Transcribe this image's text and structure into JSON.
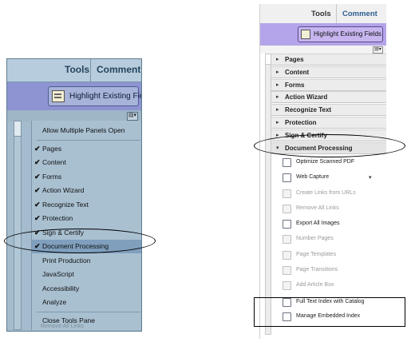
{
  "left_panel": {
    "tabs": {
      "tools": "Tools",
      "comment": "Comment"
    },
    "highlight_button": "Highlight Existing Fields",
    "menu": [
      {
        "label": "Allow Multiple Panels Open",
        "checked": false
      },
      {
        "label": "Pages",
        "checked": true
      },
      {
        "label": "Content",
        "checked": true
      },
      {
        "label": "Forms",
        "checked": true
      },
      {
        "label": "Action Wizard",
        "checked": true
      },
      {
        "label": "Recognize Text",
        "checked": true
      },
      {
        "label": "Protection",
        "checked": true
      },
      {
        "label": "Sign & Certify",
        "checked": true
      },
      {
        "label": "Document Processing",
        "checked": true,
        "selected": true
      },
      {
        "label": "Print Production",
        "checked": false
      },
      {
        "label": "JavaScript",
        "checked": false
      },
      {
        "label": "Accessibility",
        "checked": false
      },
      {
        "label": "Analyze",
        "checked": false
      },
      {
        "label": "Close Tools Pane",
        "checked": false
      }
    ],
    "check_glyph": "✔",
    "ghost_text": "Remove All Links"
  },
  "right_panel": {
    "tabs": {
      "tools": "Tools",
      "comment": "Comment"
    },
    "highlight_button": "Highlight Existing Fields",
    "sections": [
      {
        "label": "Pages",
        "open": false
      },
      {
        "label": "Content",
        "open": false
      },
      {
        "label": "Forms",
        "open": false
      },
      {
        "label": "Action Wizard",
        "open": false
      },
      {
        "label": "Recognize Text",
        "open": false
      },
      {
        "label": "Protection",
        "open": false
      },
      {
        "label": "Sign & Certify",
        "open": false
      },
      {
        "label": "Document Processing",
        "open": true
      }
    ],
    "tools": [
      {
        "label": "Optimize Scanned PDF",
        "enabled": true,
        "icon": "scan-icon"
      },
      {
        "label": "Web Capture",
        "enabled": true,
        "icon": "globe-icon",
        "dropdown": true
      },
      {
        "label": "Create Links from URLs",
        "enabled": false,
        "icon": "link-icon"
      },
      {
        "label": "Remove All Links",
        "enabled": false,
        "icon": "unlink-icon"
      },
      {
        "label": "Export All Images",
        "enabled": true,
        "icon": "image-export-icon"
      },
      {
        "label": "Number Pages",
        "enabled": false,
        "icon": "number-pages-icon"
      },
      {
        "label": "Page Templates",
        "enabled": false,
        "icon": "page-template-icon"
      },
      {
        "label": "Page Transitions",
        "enabled": false,
        "icon": "transition-icon"
      },
      {
        "label": "Add Article Box",
        "enabled": false,
        "icon": "article-box-icon"
      },
      {
        "label": "Full Text Index with Catalog",
        "enabled": true,
        "icon": "catalog-icon"
      },
      {
        "label": "Manage Embedded Index",
        "enabled": true,
        "icon": "index-icon"
      }
    ],
    "arrow_closed": "▸",
    "arrow_open": "▾",
    "dropdown_glyph": "▾"
  },
  "colors": {
    "left_accent": "#8e94d1",
    "right_accent": "#b4a4e9",
    "selected_row": "#7f9fbd"
  }
}
